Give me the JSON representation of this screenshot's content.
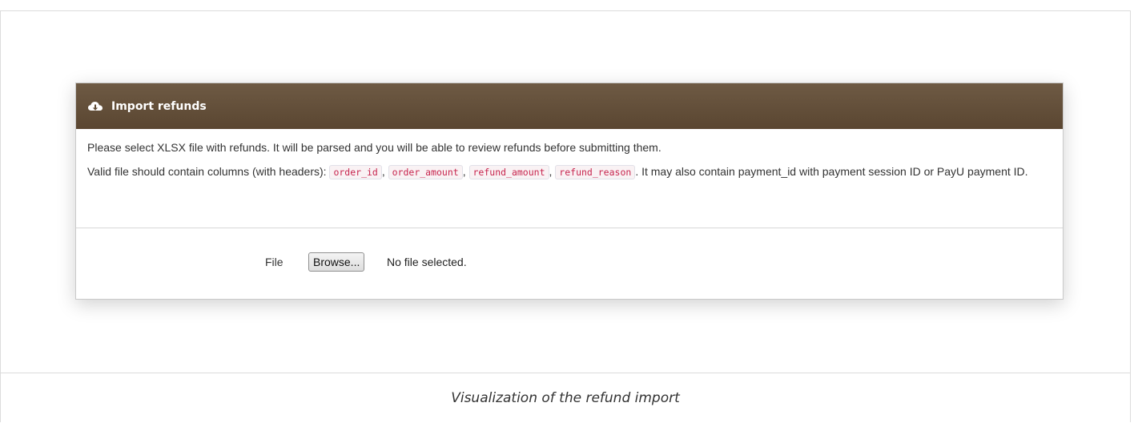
{
  "panel": {
    "icon": "cloud-download-icon",
    "title": "Import refunds",
    "header_color": "#5f4b36"
  },
  "description": {
    "line1": "Please select XLSX file with refunds. It will be parsed and you will be able to review refunds before submitting them.",
    "line2_prefix": "Valid file should contain columns (with headers): ",
    "columns": [
      "order_id",
      "order_amount",
      "refund_amount",
      "refund_reason"
    ],
    "separator": ", ",
    "line2_suffix": ". It may also contain payment_id with payment session ID or PayU payment ID."
  },
  "form": {
    "file_label": "File",
    "browse_label": "Browse...",
    "status_text": "No file selected."
  },
  "caption": "Visualization of the refund import"
}
